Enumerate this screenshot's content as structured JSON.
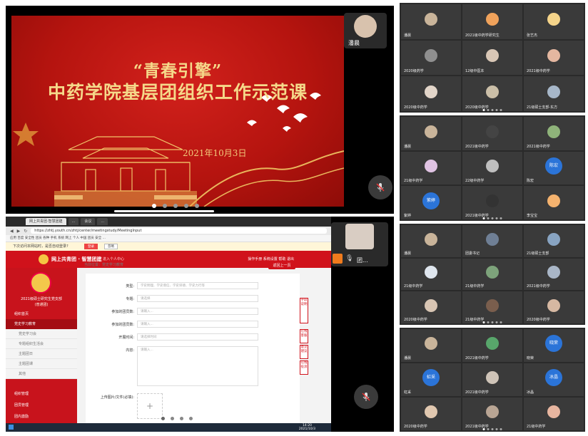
{
  "slide_panel": {
    "title_line1": "“青春引擎”",
    "title_line2": "中药学院基层团组织工作示范课",
    "date": "2021年10月3日",
    "speaker_name": "潘晨",
    "pager": {
      "count": 5,
      "active": 0
    }
  },
  "browser_panel": {
    "tabs": [
      "网上共青团·智慧团建",
      "...",
      "会议",
      "..."
    ],
    "url": "https://zhtj.youth.cn/zhtj/center/meetingstudy/MeetingInput",
    "bookmarks": "应用  百度  安全性  团员  各种  手机  系统  网上  个人  中国  团员  安全  ...",
    "notice_text": "下次访问本网站时，是否自动登录?",
    "notice_btn1": "登录",
    "notice_btn2": "忽略",
    "site_name": "网上共青团 · 智慧团建",
    "site_sub": "进入个人中心",
    "site_right": "操作手册  系统设置  帮助  退出",
    "crumb": "当前位置：党史学习教育",
    "return_label": "返回上一页",
    "nav_title": "2021级硕士研究生党支部",
    "nav_sub": "(普通团)",
    "nav_items": [
      "组织首页",
      "党史学习教育",
      "组织管理",
      "团员管理",
      "团内激励"
    ],
    "nav_subitems": [
      "党史学习会",
      "专题组织生活会",
      "主题团日",
      "主题团课",
      "其他"
    ],
    "form_rows": [
      {
        "label": "类型:",
        "value": "学史明理、学史增信、学史崇德、学史力行等"
      },
      {
        "label": "专题:",
        "value": "请选择"
      },
      {
        "label": "参加的团员数:",
        "value": "请输入..."
      },
      {
        "label": "参加的团员数:",
        "value": "请输入..."
      },
      {
        "label": "开展时间:",
        "value": "请选择时间"
      },
      {
        "label": "内容:",
        "value": "请输入..."
      }
    ],
    "upload_label": "上传图片/文件(必填):",
    "float_tags": [
      "字段说明",
      "在线客服",
      "意见建议",
      "在线投诉"
    ],
    "taskbar_time": "14:20",
    "taskbar_date": "2021/10/3",
    "speaker_name": "团...",
    "pager": {
      "count": 4,
      "active": 0
    }
  },
  "grids": [
    {
      "cells": [
        {
          "name": "潘晨",
          "avatar": "#c9b49a"
        },
        {
          "name": "2021级中药学研究生",
          "avatar": "#f0a25b"
        },
        {
          "name": "张艺杰",
          "avatar": "#f5d48a"
        },
        {
          "name": "2020级药学",
          "avatar": "#8f8f8f"
        },
        {
          "name": "12级中医本",
          "avatar": "#d9c7b6"
        },
        {
          "name": "2021级中药学",
          "avatar": "#e4b7a0"
        },
        {
          "name": "2020级中药学",
          "avatar": "#e2d5c9"
        },
        {
          "name": "2020级中药学",
          "avatar": "#cbbfa8"
        },
        {
          "name": "21级硕士支部-东方",
          "avatar": "#a7b7c9"
        }
      ]
    },
    {
      "cells": [
        {
          "name": "潘晨",
          "avatar": "#c9b49a"
        },
        {
          "name": "2021级中药学",
          "avatar": "#444444"
        },
        {
          "name": "2021级中药学",
          "avatar": "#8fb37a"
        },
        {
          "name": "21级中药学",
          "avatar": "#e0c3e3"
        },
        {
          "name": "22级中药学",
          "avatar": "#bfbfbf"
        },
        {
          "name": "陈宏",
          "avatar": "#2b74d8",
          "text": "陈宏"
        },
        {
          "name": "紫婷",
          "avatar": "#2b74d8",
          "text": "紫婷"
        },
        {
          "name": "2021级中药学",
          "avatar": "#333333"
        },
        {
          "name": "李宝宝",
          "avatar": "#f4b26e"
        }
      ]
    },
    {
      "cells": [
        {
          "name": "潘晨",
          "avatar": "#c9b49a"
        },
        {
          "name": "团委书记",
          "avatar": "#6f7f95"
        },
        {
          "name": "21级硕士支部",
          "avatar": "#88a4c2"
        },
        {
          "name": "21级中药学",
          "avatar": "#dfe6ee"
        },
        {
          "name": "21级中药学",
          "avatar": "#7da37b"
        },
        {
          "name": "2021级中药学",
          "avatar": "#a9b6c7"
        },
        {
          "name": "2020级中药学",
          "avatar": "#d8c5b3"
        },
        {
          "name": "21级中药学",
          "avatar": "#7a5e4d"
        },
        {
          "name": "2020级中药学",
          "avatar": "#d6b8a2"
        }
      ]
    },
    {
      "cells": [
        {
          "name": "潘晨",
          "avatar": "#c9b49a"
        },
        {
          "name": "2021级中药学",
          "avatar": "#58a66b"
        },
        {
          "name": "晓荣",
          "avatar": "#2b74d8",
          "text": "晓荣"
        },
        {
          "name": "虹采",
          "avatar": "#2b74d8",
          "text": "虹采"
        },
        {
          "name": "2021级中药学",
          "avatar": "#cfc4b8"
        },
        {
          "name": "冰晶",
          "avatar": "#2b74d8",
          "text": "冰晶"
        },
        {
          "name": "2020级中药学",
          "avatar": "#e1c8b0"
        },
        {
          "name": "2021级中药学",
          "avatar": "#b9a594"
        },
        {
          "name": "21级中药学",
          "avatar": "#e8b6a0"
        }
      ]
    }
  ]
}
